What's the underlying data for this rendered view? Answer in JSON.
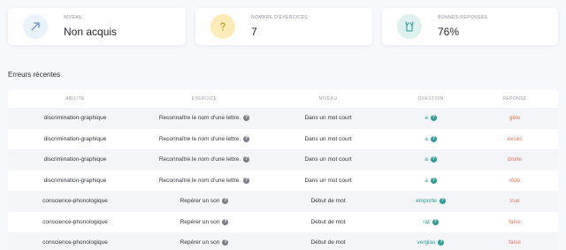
{
  "cards": [
    {
      "label": "NIVEAU",
      "value": "Non acquis",
      "icon": "trend-arrow-icon",
      "circle_color": "#eaf2fd",
      "icon_color": "#5b8fd6"
    },
    {
      "label": "NOMBRE D'EXERCICES",
      "value": "7",
      "icon": "question-mark-icon",
      "circle_color": "#fdebb8",
      "icon_color": "#c79a1c"
    },
    {
      "label": "BONNES RÉPONSES",
      "value": "76%",
      "icon": "hands-up-icon",
      "circle_color": "#dff1ee",
      "icon_color": "#2a9f96"
    }
  ],
  "section_title": "Erreurs récentes",
  "columns": [
    "ABILITÉ",
    "EXERCICE",
    "NIVEAU",
    "QUESTION",
    "RÉPONSE"
  ],
  "rows": [
    {
      "ability": "discrimination-graphique",
      "exercise": "Reconnaître le nom d'une lettre.",
      "level": "Dans un mot court",
      "question": "a",
      "response": "gèle"
    },
    {
      "ability": "discrimination-graphique",
      "exercise": "Reconnaître le nom d'une lettre.",
      "level": "Dans un mot court",
      "question": "a",
      "response": "excès"
    },
    {
      "ability": "discrimination-graphique",
      "exercise": "Reconnaître le nom d'une lettre.",
      "level": "Dans un mot court",
      "question": "a",
      "response": "droite"
    },
    {
      "ability": "discrimination-graphique",
      "exercise": "Reconnaître le nom d'une lettre.",
      "level": "Dans un mot court",
      "question": "a",
      "response": "rôde"
    },
    {
      "ability": "conscience-phonologique",
      "exercise": "Repérer un son",
      "level": "Début de mot",
      "question": "emporte",
      "response": "true"
    },
    {
      "ability": "conscience-phonologique",
      "exercise": "Repérer un son",
      "level": "Début de mot",
      "question": "rat",
      "response": "false"
    },
    {
      "ability": "conscience-phonologique",
      "exercise": "Repérer un son",
      "level": "Début de mot",
      "question": "verglas",
      "response": "false"
    }
  ],
  "colors": {
    "accent_teal": "#2a9f96",
    "error_orange": "#f0765c"
  },
  "help_glyph": "?"
}
